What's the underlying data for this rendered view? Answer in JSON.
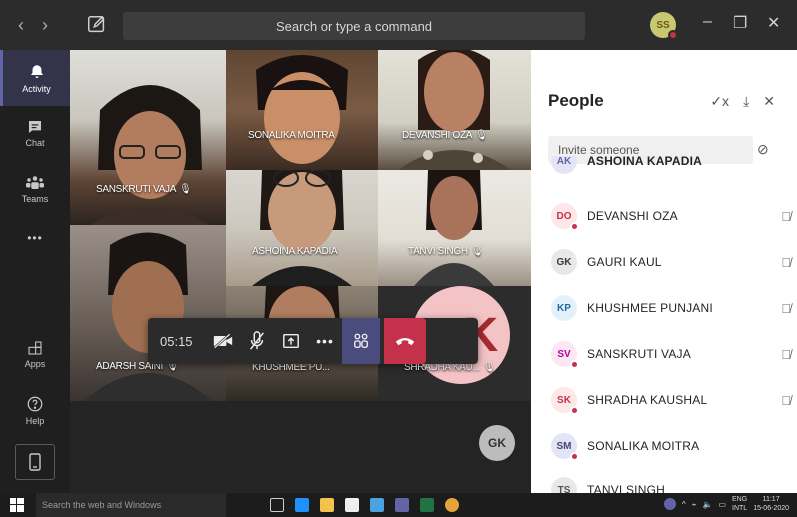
{
  "titlebar": {
    "search_placeholder": "Search or type a command",
    "user_initials": "SS",
    "back_glyph": "‹",
    "forward_glyph": "›",
    "minimize_glyph": "–",
    "maximize_glyph": "❐",
    "close_glyph": "✕"
  },
  "rail": {
    "items": [
      {
        "label": "Activity",
        "icon": "bell-icon"
      },
      {
        "label": "Chat",
        "icon": "chat-icon"
      },
      {
        "label": "Teams",
        "icon": "teams-icon"
      },
      {
        "label": "",
        "icon": "more-icon"
      },
      {
        "label": "Apps",
        "icon": "apps-icon"
      },
      {
        "label": "Help",
        "icon": "help-icon"
      }
    ],
    "more_glyph": "•••"
  },
  "meeting": {
    "participants": [
      {
        "name": "SANSKRUTI VAJA",
        "muted": true
      },
      {
        "name": "SONALIKA MOITRA",
        "muted": false
      },
      {
        "name": "DEVANSHI OZA",
        "muted": true
      },
      {
        "name": "ASHOINA KAPADIA",
        "muted": false
      },
      {
        "name": "TANVI SINGH",
        "muted": true
      },
      {
        "name": "ADARSH SAINI",
        "muted": true
      },
      {
        "name": "KHUSHMEE PU...",
        "muted": false
      },
      {
        "name": "SHRADHA KAU...",
        "muted": true
      }
    ],
    "shradha_initial": "K",
    "mic_off_glyph": "🎙̸",
    "timer": "05:15",
    "self_initials": "GK"
  },
  "people_panel": {
    "title": "People",
    "invite_placeholder": "Invite someone",
    "link_glyph": "🔗",
    "header_icons": {
      "mute_all": "✓x",
      "download": "⤓",
      "close": "✕"
    },
    "partial_top": {
      "initials": "AK",
      "name": "ASHOINA KAPADIA",
      "color": "#e3e4f6",
      "text_color": "#6264a7"
    },
    "people": [
      {
        "initials": "DO",
        "name": "DEVANSHI OZA",
        "bg": "#fde7e9",
        "fg": "#c4314b",
        "muted": true
      },
      {
        "initials": "GK",
        "name": "GAURI KAUL",
        "bg": "#e8e8e8",
        "fg": "#3a3a3a",
        "muted": true
      },
      {
        "initials": "KP",
        "name": "KHUSHMEE PUNJANI",
        "bg": "#e3f2fa",
        "fg": "#1f6f9a",
        "muted": true
      },
      {
        "initials": "SV",
        "name": "SANSKRUTI VAJA",
        "bg": "#fde7f3",
        "fg": "#b4009e",
        "muted": true
      },
      {
        "initials": "SK",
        "name": "SHRADHA KAUSHAL",
        "bg": "#fde7e9",
        "fg": "#c4314b",
        "muted": true
      },
      {
        "initials": "SM",
        "name": "SONALIKA MOITRA",
        "bg": "#e3e4f6",
        "fg": "#464775",
        "muted": false
      }
    ],
    "partial_bottom": {
      "initials": "TS",
      "name": "TANVI SINGH"
    }
  },
  "taskbar": {
    "search_placeholder": "Search the web and Windows",
    "lang": "ENG",
    "region": "INTL",
    "time": "11:17",
    "date": "15-06-2020"
  },
  "colors": {
    "accent": "#6264a7",
    "hangup": "#c4314b",
    "shradha_bg": "#f4c3c6",
    "shradha_text": "#a62a2f"
  }
}
